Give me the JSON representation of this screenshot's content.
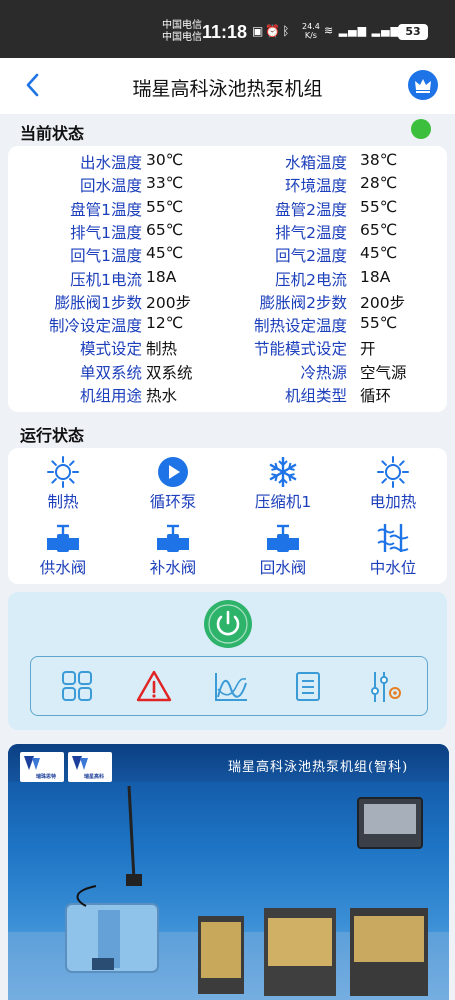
{
  "status_bar": {
    "carrier1": "中国电信",
    "carrier2": "中国电信",
    "time": "11:18",
    "net_speed_value": "24.4",
    "net_speed_unit": "K/s",
    "battery": "53"
  },
  "nav": {
    "title": "瑞星高科泳池热泵机组"
  },
  "current_status": {
    "section_title": "当前状态",
    "online_color": "#3cbf3c",
    "rows": [
      {
        "l1": "出水温度",
        "v1": "30℃",
        "l2": "水箱温度",
        "v2": "38℃"
      },
      {
        "l1": "回水温度",
        "v1": "33℃",
        "l2": "环境温度",
        "v2": "28℃"
      },
      {
        "l1": "盘管1温度",
        "v1": "55℃",
        "l2": "盘管2温度",
        "v2": "55℃"
      },
      {
        "l1": "排气1温度",
        "v1": "65℃",
        "l2": "排气2温度",
        "v2": "65℃"
      },
      {
        "l1": "回气1温度",
        "v1": "45℃",
        "l2": "回气2温度",
        "v2": "45℃"
      },
      {
        "l1": "压机1电流",
        "v1": "18A",
        "l2": "压机2电流",
        "v2": "18A"
      },
      {
        "l1": "膨胀阀1步数",
        "v1": "200步",
        "l2": "膨胀阀2步数",
        "v2": "200步"
      },
      {
        "l1": "制冷设定温度",
        "v1": "12℃",
        "l2": "制热设定温度",
        "v2": "55℃"
      },
      {
        "l1": "模式设定",
        "v1": "制热",
        "l2": "节能模式设定",
        "v2": "开"
      },
      {
        "l1": "单双系统",
        "v1": "双系统",
        "l2": "冷热源",
        "v2": "空气源"
      },
      {
        "l1": "机组用途",
        "v1": "热水",
        "l2": "机组类型",
        "v2": "循环"
      }
    ]
  },
  "running_state": {
    "section_title": "运行状态",
    "items": [
      {
        "label": "制热",
        "icon": "sun-icon"
      },
      {
        "label": "循环泵",
        "icon": "play-circle-icon"
      },
      {
        "label": "压缩机1",
        "icon": "snowflake-icon"
      },
      {
        "label": "电加热",
        "icon": "sun-icon"
      },
      {
        "label": "供水阀",
        "icon": "valve-icon"
      },
      {
        "label": "补水阀",
        "icon": "valve-icon"
      },
      {
        "label": "回水阀",
        "icon": "valve-icon"
      },
      {
        "label": "中水位",
        "icon": "water-level-icon"
      }
    ]
  },
  "controls": {
    "tools": [
      "grid-icon",
      "alarm-icon",
      "chart-icon",
      "list-icon",
      "settings-sliders-icon"
    ]
  },
  "banner": {
    "title": "瑞星高科泳池热泵机组(智科)",
    "brand1": "瑞珠思特",
    "brand2": "瑞星高科"
  },
  "colors": {
    "accent": "#1e73e6",
    "label_blue": "#1c3fbb",
    "power_green": "#2db36a"
  }
}
